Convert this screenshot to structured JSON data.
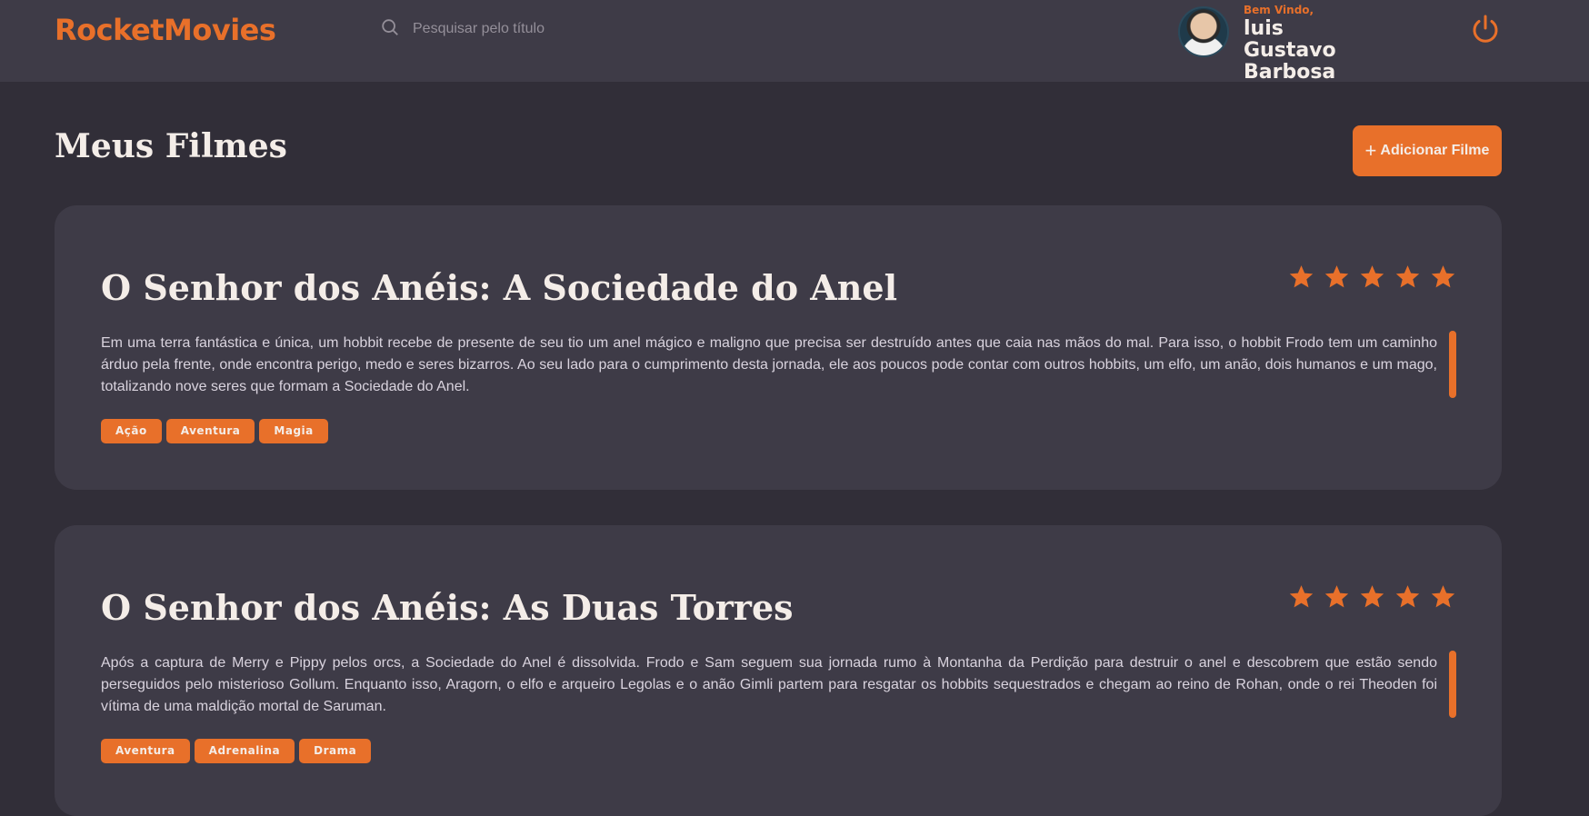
{
  "header": {
    "logo": "RocketMovies",
    "search_placeholder": "Pesquisar pelo título",
    "welcome": "Bem Vindo,",
    "username": "luis Gustavo Barbosa"
  },
  "main": {
    "title": "Meus Filmes",
    "add_button_label": "Adicionar Filme",
    "movies": [
      {
        "title": "O Senhor dos Anéis: A Sociedade do Anel",
        "rating": 5,
        "description": "Em uma terra fantástica e única, um hobbit recebe de presente de seu tio um anel mágico e maligno que precisa ser destruído antes que caia nas mãos do mal. Para isso, o hobbit Frodo tem um caminho árduo pela frente, onde encontra perigo, medo e seres bizarros. Ao seu lado para o cumprimento desta jornada, ele aos poucos pode contar com outros hobbits, um elfo, um anão, dois humanos e um mago, totalizando nove seres que formam a Sociedade do Anel.",
        "tags": [
          "Ação",
          "Aventura",
          "Magia"
        ]
      },
      {
        "title": "O Senhor dos Anéis: As Duas Torres",
        "rating": 5,
        "description": "Após a captura de Merry e Pippy pelos orcs, a Sociedade do Anel é dissolvida. Frodo e Sam seguem sua jornada rumo à Montanha da Perdição para destruir o anel e descobrem que estão sendo perseguidos pelo misterioso Gollum. Enquanto isso, Aragorn, o elfo e arqueiro Legolas e o anão Gimli partem para resgatar os hobbits sequestrados e chegam ao reino de Rohan, onde o rei Theoden foi vítima de uma maldição mortal de Saruman.",
        "tags": [
          "Aventura",
          "Adrenalina",
          "Drama"
        ]
      }
    ]
  },
  "icons": {
    "search": "search-icon",
    "logout": "power-icon",
    "star": "star-icon",
    "plus": "plus-icon"
  },
  "colors": {
    "accent": "#E8702A",
    "background": "#312E38",
    "surface": "#3E3B47",
    "text": "#F4EDE8"
  }
}
